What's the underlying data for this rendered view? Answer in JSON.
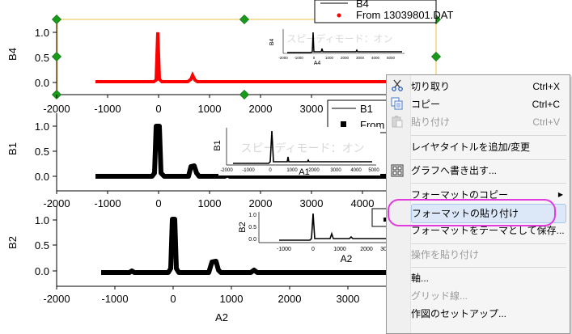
{
  "graph": {
    "panels": [
      {
        "ylabel": "B4",
        "yticks": [
          "1.0",
          "0.5",
          "0.0"
        ],
        "xticks": [
          "-2000",
          "-1000",
          "0",
          "1000",
          "2000",
          "3000"
        ]
      },
      {
        "ylabel": "B1",
        "yticks": [
          "1.0",
          "0.5",
          "0.0"
        ],
        "xticks": [
          "-2000",
          "-1000",
          "0",
          "1000",
          "2000",
          "3000",
          "4000"
        ]
      },
      {
        "ylabel": "B2",
        "yticks": [
          "1.0",
          "0.5",
          "0.0"
        ],
        "xticks": [
          "-2000",
          "-1000",
          "0",
          "1000",
          "2000",
          "3000"
        ],
        "xlabel": "A2"
      }
    ],
    "legend_top": {
      "line1": "B4",
      "line2": "From 13039801.DAT"
    },
    "legend_mid": {
      "line1": "B1",
      "line2": "From"
    },
    "insets": [
      {
        "ylabel": "B4",
        "xlabel": "A4",
        "xticks": [
          "-2000",
          "-1000",
          "0",
          "1000",
          "2000",
          "3000",
          "4000",
          "5000"
        ],
        "watermark": "スピーディモード：オン"
      },
      {
        "ylabel": "B1",
        "xlabel": "A1",
        "xticks": [
          "-2000",
          "-1000",
          "0",
          "1000",
          "2000",
          "3000",
          "4000",
          "5000"
        ],
        "watermark": "スピーディモード：オン"
      },
      {
        "ylabel": "B2",
        "xlabel": "A2",
        "xticks": [
          "-1000",
          "0",
          "1000",
          "2000",
          "3000"
        ],
        "yticks": [
          "1.0",
          "0.5",
          "0.0"
        ]
      }
    ],
    "colors": {
      "top_series": "#ff0000",
      "series": "#000000",
      "selection": "#f0c040",
      "handle": "#1a9a1a"
    }
  },
  "menu": {
    "items": [
      {
        "label": "切り取り",
        "shortcut": "Ctrl+X",
        "icon": "scissors-icon",
        "disabled": false
      },
      {
        "label": "コピー",
        "shortcut": "Ctrl+C",
        "icon": "copy-icon",
        "disabled": false
      },
      {
        "label": "貼り付け",
        "shortcut": "Ctrl+V",
        "icon": "paste-icon",
        "disabled": true
      },
      {
        "label": "レイヤタイトルを追加/変更",
        "shortcut": "",
        "disabled": false
      },
      {
        "label": "グラフへ書き出す...",
        "shortcut": "",
        "icon": "export-graph-icon",
        "disabled": false
      },
      {
        "label": "フォーマットのコピー",
        "shortcut": "",
        "submenu": true,
        "disabled": false
      },
      {
        "label": "フォーマットの貼り付け",
        "shortcut": "",
        "disabled": false,
        "highlighted": true
      },
      {
        "label": "フォーマットをテーマとして保存...",
        "shortcut": "",
        "disabled": false
      },
      {
        "label": "操作を貼り付け",
        "shortcut": "",
        "disabled": true
      },
      {
        "label": "軸...",
        "shortcut": "",
        "disabled": false
      },
      {
        "label": "グリッド線...",
        "shortcut": "",
        "disabled": true
      },
      {
        "label": "作図のセットアップ...",
        "shortcut": "",
        "disabled": false
      }
    ]
  }
}
